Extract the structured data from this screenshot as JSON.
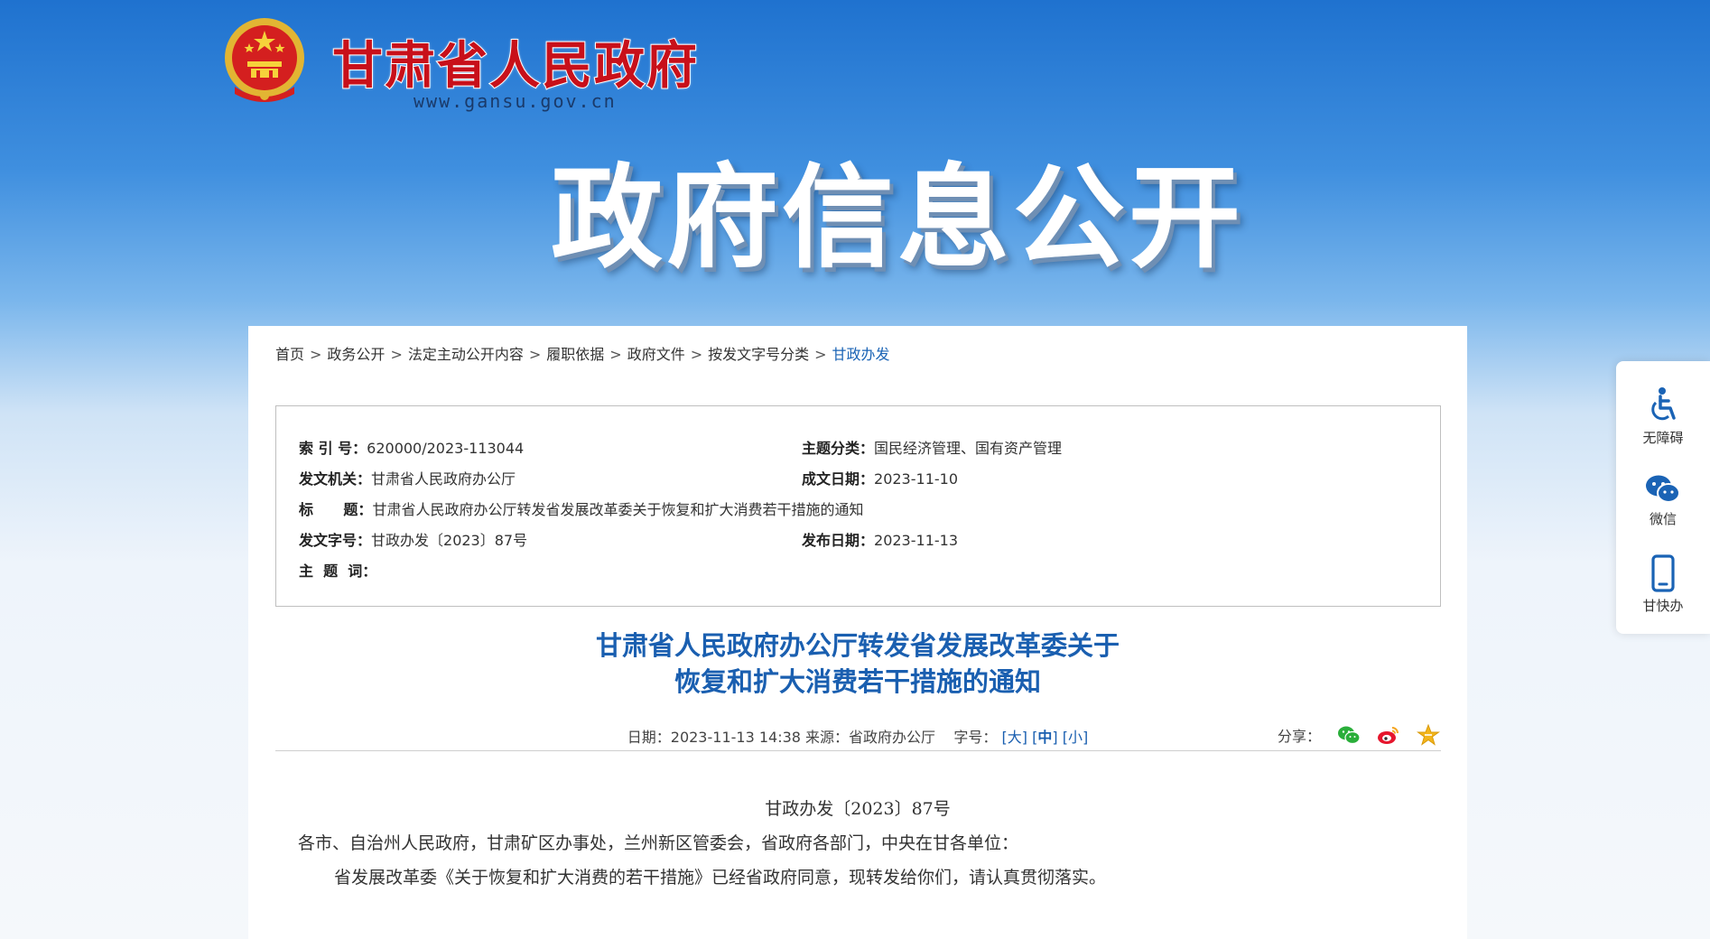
{
  "header": {
    "site_title": "甘肃省人民政府",
    "site_url": "www.gansu.gov.cn",
    "banner_title": "政府信息公开"
  },
  "breadcrumb": {
    "items": [
      "首页",
      "政务公开",
      "法定主动公开内容",
      "履职依据",
      "政府文件",
      "按发文字号分类"
    ],
    "current": "甘政办发",
    "separator": ">"
  },
  "info": {
    "index_label": "索  引  号：",
    "index_value": "620000/2023-113044",
    "topic_label": "主题分类：",
    "topic_value": "国民经济管理、国有资产管理",
    "issuer_label": "发文机关：",
    "issuer_value": "甘肃省人民政府办公厅",
    "created_label": "成文日期：",
    "created_value": "2023-11-10",
    "title_label": "标      题：",
    "title_value": "甘肃省人民政府办公厅转发省发展改革委关于恢复和扩大消费若干措施的通知",
    "docno_label": "发文字号：",
    "docno_value": "甘政办发〔2023〕87号",
    "published_label": "发布日期：",
    "published_value": "2023-11-13",
    "keywords_label": "主  题  词："
  },
  "article": {
    "title_line1": "甘肃省人民政府办公厅转发省发展改革委关于",
    "title_line2": "恢复和扩大消费若干措施的通知",
    "meta_date": "日期：2023-11-13 14:38 来源：省政府办公厅",
    "font_size_label": "字号：",
    "font_large": "大",
    "font_medium": "中",
    "font_small": "小",
    "share_label": "分享：",
    "doc_number": "甘政办发〔2023〕87号",
    "recipients": "各市、自治州人民政府，甘肃矿区办事处，兰州新区管委会，省政府各部门，中央在甘各单位：",
    "paragraph1": "省发展改革委《关于恢复和扩大消费的若干措施》已经省政府同意，现转发给你们，请认真贯彻落实。"
  },
  "floatbar": {
    "accessibility": "无障碍",
    "wechat": "微信",
    "mobile": "甘快办"
  },
  "colors": {
    "brand_red": "#c8101a",
    "link_blue": "#1a5fb0",
    "header_blue": "#1f72cf"
  }
}
